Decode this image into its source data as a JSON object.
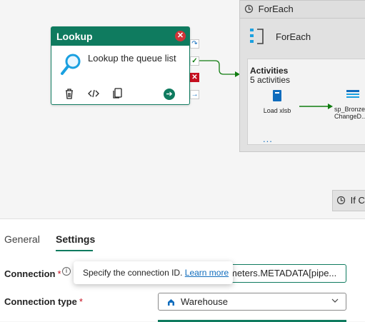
{
  "canvas": {
    "lookup": {
      "title": "Lookup",
      "description": "Lookup the queue list",
      "icons": [
        "search-icon",
        "delete-icon",
        "code-icon",
        "copy-icon",
        "go-arrow-icon"
      ]
    },
    "foreach": {
      "header": "ForEach",
      "title": "ForEach",
      "activities_title": "Activities",
      "activities_count": "5 activities",
      "items": [
        {
          "label": "Load xlsb",
          "icon": "notebook-icon"
        },
        {
          "label": "sp_Bronze ChangeD...",
          "icon": "stored-procedure-icon"
        }
      ],
      "more": "..."
    },
    "if_condition": {
      "header": "If C"
    }
  },
  "panel": {
    "tabs": [
      {
        "label": "General",
        "active": false
      },
      {
        "label": "Settings",
        "active": true
      }
    ],
    "connection": {
      "label": "Connection",
      "required": "*",
      "tooltip_text": "Specify the connection ID.",
      "tooltip_link": "Learn more",
      "value": "meters.METADATA[pipe..."
    },
    "connection_type": {
      "label": "Connection type",
      "required": "*",
      "value": "Warehouse"
    }
  },
  "colors": {
    "accent": "#0f7b5f",
    "link": "#0f6cbd",
    "error": "#d13438"
  }
}
